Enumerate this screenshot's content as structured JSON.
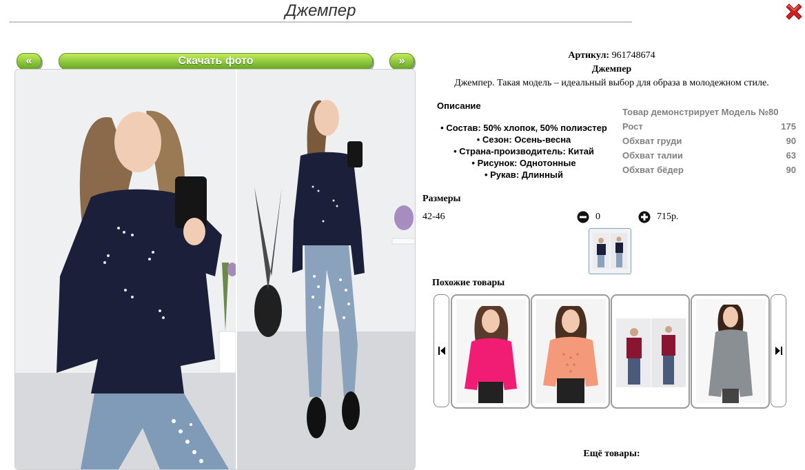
{
  "page": {
    "title": "Джемпер"
  },
  "nav": {
    "prev_label": "«",
    "download_label": "Скачать фото",
    "next_label": "»"
  },
  "product": {
    "article_label": "Артикул:",
    "article_value": "961748674",
    "name": "Джемпер",
    "description": "Джемпер. Такая модель – идеальный выбор для образа в молодежном стиле.",
    "desc_heading": "Описание",
    "features": [
      "Состав: 50% хлопок, 50% полиэстер",
      "Сезон: Осень-весна",
      "Страна-производитель: Китай",
      "Рисунок: Однотонные",
      "Рукав: Длинный"
    ]
  },
  "model": {
    "heading": "Товар демонстрирует Модель №80",
    "rows": [
      {
        "label": "Рост",
        "value": "175"
      },
      {
        "label": "Обхват груди",
        "value": "90"
      },
      {
        "label": "Обхват талии",
        "value": "63"
      },
      {
        "label": "Обхват бёдер",
        "value": "90"
      }
    ]
  },
  "sizes": {
    "heading": "Размеры",
    "size": "42-46",
    "quantity": "0",
    "price": "715р."
  },
  "similar": {
    "heading": "Похожие товары",
    "count": 4
  },
  "more": {
    "heading": "Ещё товары:"
  },
  "colors": {
    "green_top": "#c6eb5a",
    "green_bottom": "#6aa728",
    "close_red": "#d41f1f",
    "sweater_navy": "#1b1f3a"
  },
  "icons": {
    "close": "close-x-icon",
    "minus": "minus-circle-icon",
    "plus": "plus-circle-icon",
    "carousel_prev": "skip-back-icon",
    "carousel_next": "skip-forward-icon"
  }
}
